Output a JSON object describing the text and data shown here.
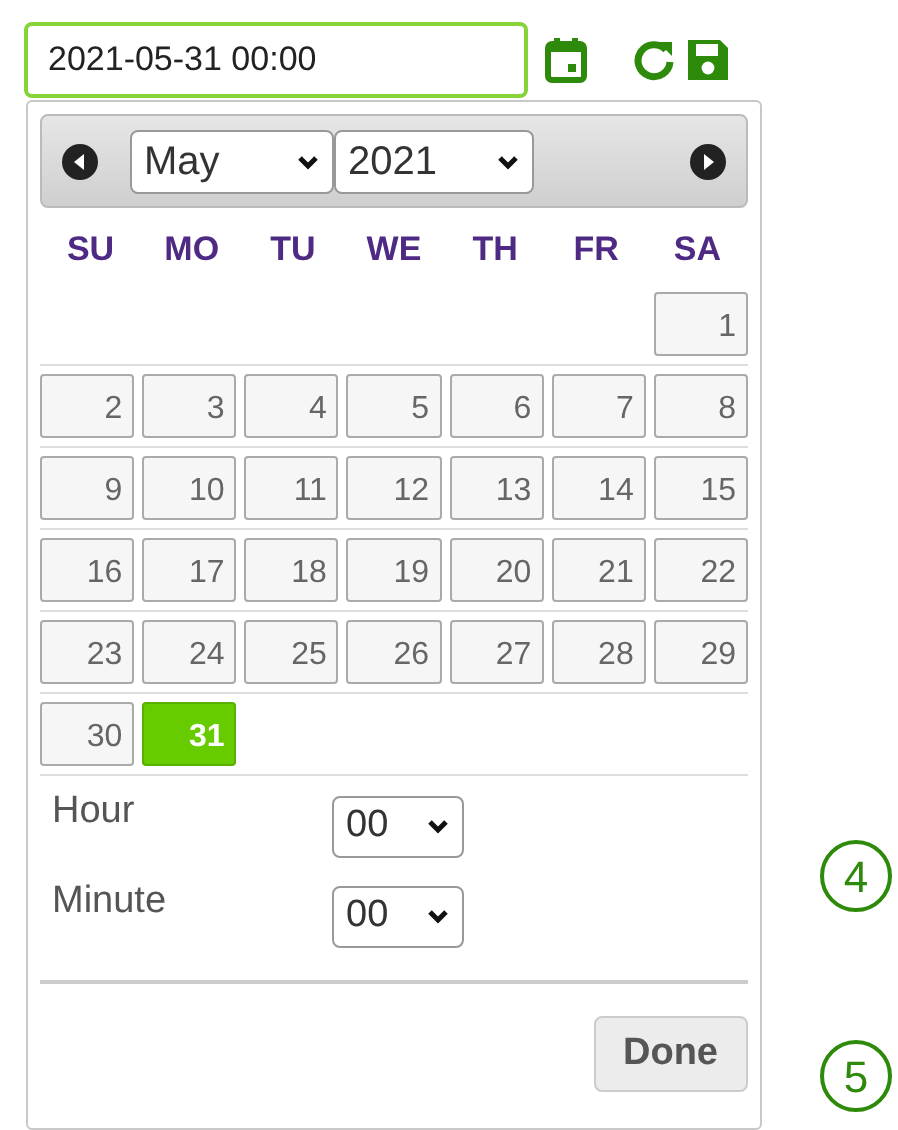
{
  "date_field": {
    "value": "2021-05-31 00:00"
  },
  "calendar": {
    "month": "May",
    "year": "2021",
    "weekdays": [
      "SU",
      "MO",
      "TU",
      "WE",
      "TH",
      "FR",
      "SA"
    ],
    "weeks": [
      [
        {
          "day": "1",
          "selected": false
        }
      ],
      [
        {
          "day": "2",
          "selected": false
        },
        {
          "day": "3",
          "selected": false
        },
        {
          "day": "4",
          "selected": false
        },
        {
          "day": "5",
          "selected": false
        },
        {
          "day": "6",
          "selected": false
        },
        {
          "day": "7",
          "selected": false
        },
        {
          "day": "8",
          "selected": false
        }
      ],
      [
        {
          "day": "9",
          "selected": false
        },
        {
          "day": "10",
          "selected": false
        },
        {
          "day": "11",
          "selected": false
        },
        {
          "day": "12",
          "selected": false
        },
        {
          "day": "13",
          "selected": false
        },
        {
          "day": "14",
          "selected": false
        },
        {
          "day": "15",
          "selected": false
        }
      ],
      [
        {
          "day": "16",
          "selected": false
        },
        {
          "day": "17",
          "selected": false
        },
        {
          "day": "18",
          "selected": false
        },
        {
          "day": "19",
          "selected": false
        },
        {
          "day": "20",
          "selected": false
        },
        {
          "day": "21",
          "selected": false
        },
        {
          "day": "22",
          "selected": false
        }
      ],
      [
        {
          "day": "23",
          "selected": false
        },
        {
          "day": "24",
          "selected": false
        },
        {
          "day": "25",
          "selected": false
        },
        {
          "day": "26",
          "selected": false
        },
        {
          "day": "27",
          "selected": false
        },
        {
          "day": "28",
          "selected": false
        },
        {
          "day": "29",
          "selected": false
        }
      ],
      [
        {
          "day": "30",
          "selected": false
        },
        {
          "day": "31",
          "selected": true
        }
      ]
    ],
    "time": [
      {
        "label": "Hour",
        "value": "00"
      },
      {
        "label": "Minute",
        "value": "00"
      }
    ],
    "done_button": "Done"
  },
  "step_markers": [
    "4",
    "5"
  ]
}
